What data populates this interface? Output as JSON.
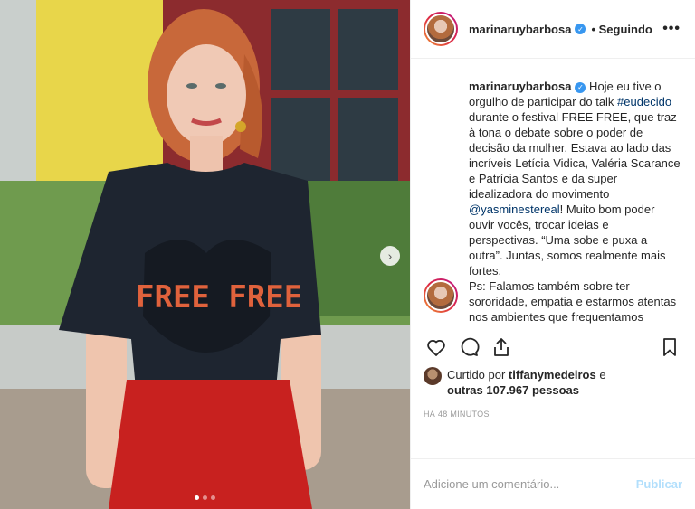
{
  "post": {
    "username": "marinaruybarbosa",
    "follow_status": "Seguindo",
    "more_icon": "ellipsis-icon"
  },
  "caption": {
    "author": "marinaruybarbosa",
    "part1": " Hoje eu tive o orgulho de participar do talk ",
    "hashtag": "#eudecido",
    "part2": " durante o festival FREE FREE, que traz à tona o debate sobre o poder de decisão da mulher. Estava ao lado das incríveis Letícia Vidica, Valéria Scarance e Patrícia Santos e da super idealizadora do movimento ",
    "mention": "@yasminestereal",
    "part3": "! Muito bom poder ouvir vocês, trocar ideias e perspectivas. “Uma sobe e puxa a outra”. Juntas, somos realmente mais fortes.",
    "ps": "Ps: Falamos também sobre ter sororidade, empatia e estarmos atentas nos ambientes que frequentamos sempre, escola, trabalho… Alguém que está bem pertinho de você, passando por um"
  },
  "likes": {
    "prefix": "Curtido por ",
    "user": "tiffanymedeiros",
    "connector": " e",
    "others": "outras 107.967 pessoas"
  },
  "timestamp": "HÁ 48 MINUTOS",
  "comment_box": {
    "placeholder": "Adicione um comentário...",
    "publish": "Publicar"
  },
  "shirt_text": "FREE FREE",
  "colors": {
    "verified": "#3897f0",
    "link": "#003569",
    "publish_disabled": "#b2dffc"
  },
  "carousel": {
    "current": 1,
    "total": 3
  }
}
